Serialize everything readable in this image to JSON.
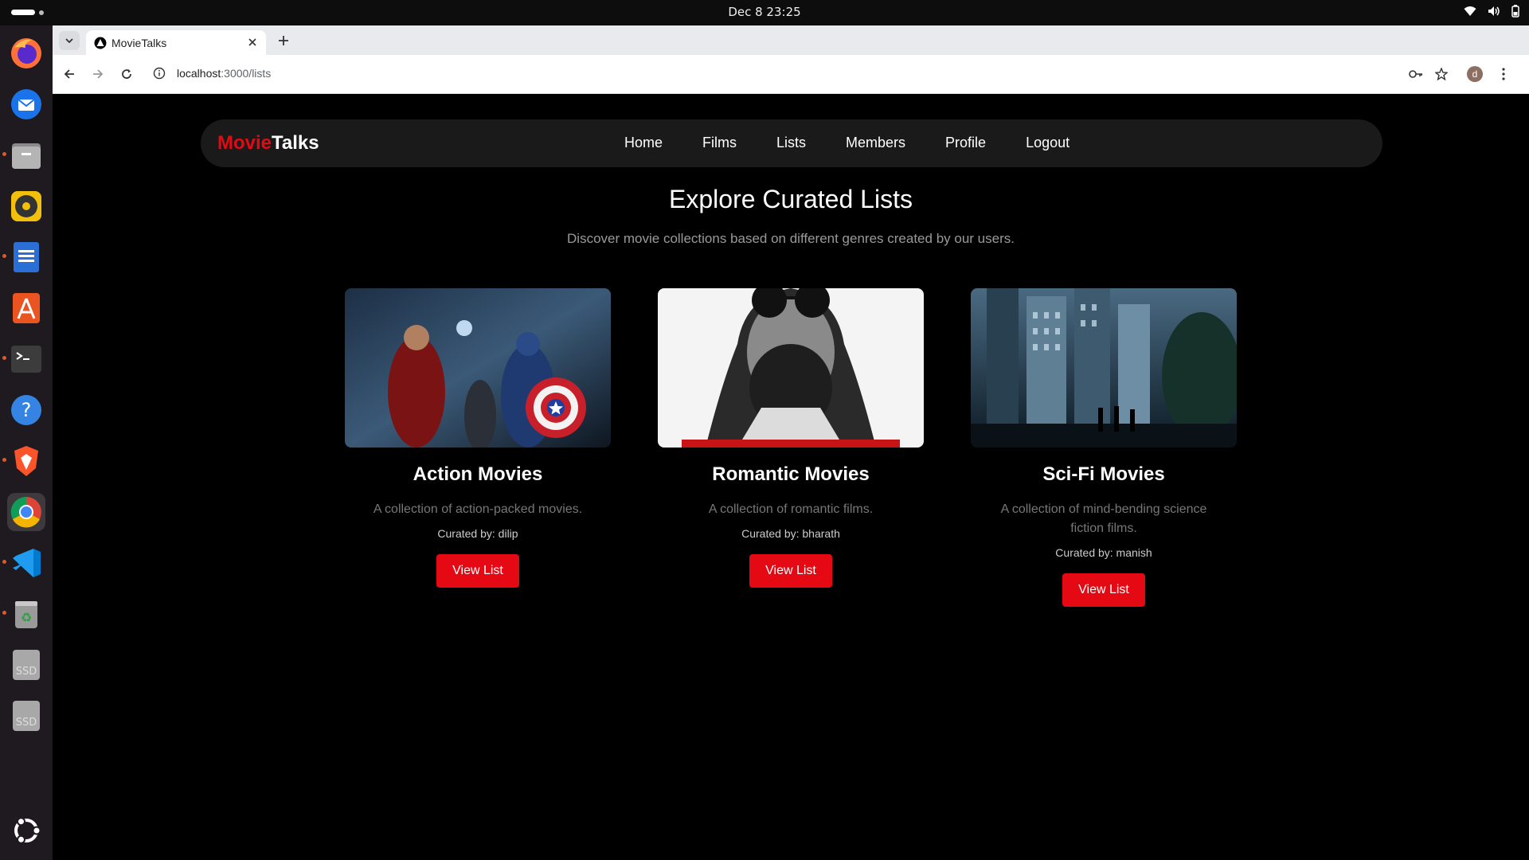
{
  "system": {
    "clock": "Dec 8  23:25"
  },
  "dock": {
    "items": [
      "firefox-icon",
      "thunderbird-icon",
      "files-icon",
      "rhythmbox-icon",
      "writer-icon",
      "app-center-icon",
      "terminal-icon",
      "help-icon",
      "brave-icon",
      "chrome-icon",
      "vscode-icon",
      "trash-icon",
      "ssd-drive-icon",
      "ssd-drive-icon",
      "ubuntu-apps-icon"
    ],
    "ssd_label": "SSD"
  },
  "browser": {
    "tab_title": "MovieTalks",
    "url_host": "localhost",
    "url_rest": ":3000/lists",
    "profile_initial": "d"
  },
  "site": {
    "logo_part1": "Movie",
    "logo_part2": "Talks",
    "nav": [
      "Home",
      "Films",
      "Lists",
      "Members",
      "Profile",
      "Logout"
    ],
    "heading": "Explore Curated Lists",
    "subheading": "Discover movie collections based on different genres created by our users.",
    "accent": "#e50914"
  },
  "lists": [
    {
      "title": "Action Movies",
      "description": "A collection of action-packed movies.",
      "curator": "Curated by: dilip",
      "button": "View List"
    },
    {
      "title": "Romantic Movies",
      "description": "A collection of romantic films.",
      "curator": "Curated by: bharath",
      "button": "View List"
    },
    {
      "title": "Sci-Fi Movies",
      "description": "A collection of mind-bending science fiction films.",
      "curator": "Curated by: manish",
      "button": "View List"
    }
  ]
}
